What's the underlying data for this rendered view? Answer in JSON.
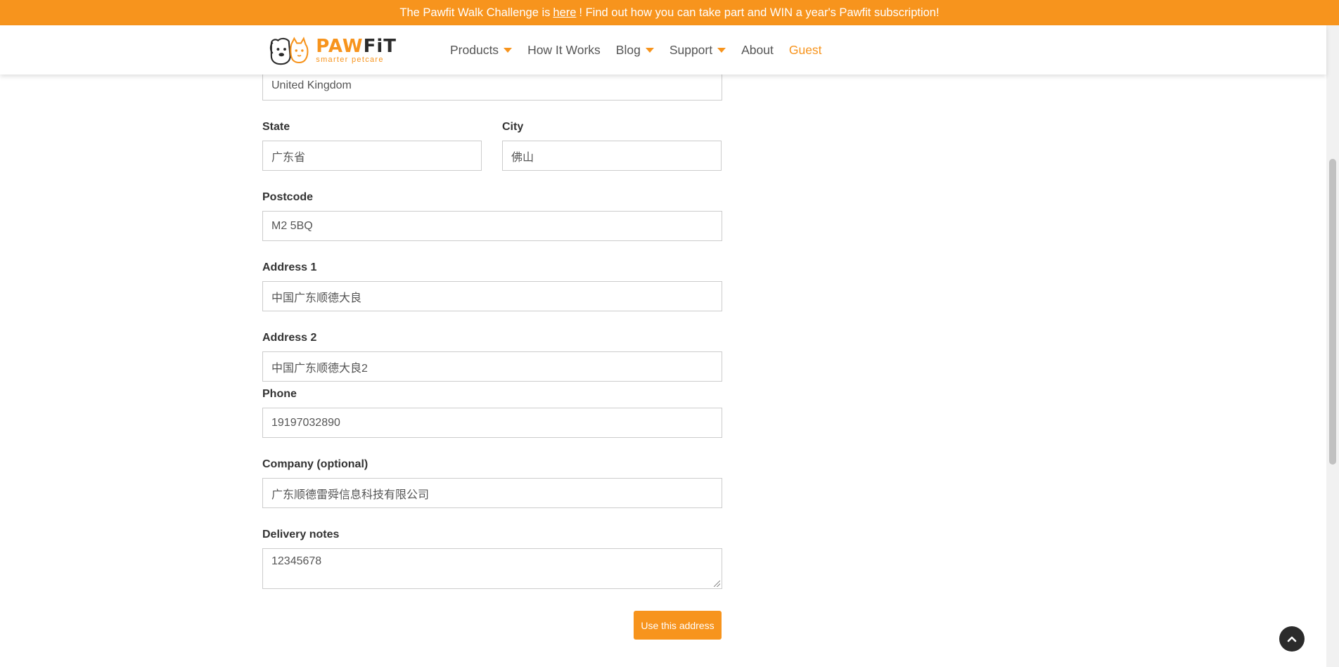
{
  "banner": {
    "text_before": "The Pawfit Walk Challenge is",
    "link": "here",
    "text_after": "! Find out how you can take part and WIN a year's Pawfit subscription!"
  },
  "header": {
    "logo_word_paw": "PAW",
    "logo_word_fit": "FiT",
    "logo_tagline": "smarter petcare",
    "nav": [
      {
        "label": "Products",
        "has_dropdown": true
      },
      {
        "label": "How It Works",
        "has_dropdown": false
      },
      {
        "label": "Blog",
        "has_dropdown": true
      },
      {
        "label": "Support",
        "has_dropdown": true
      },
      {
        "label": "About",
        "has_dropdown": false
      },
      {
        "label": "Guest",
        "has_dropdown": false
      }
    ]
  },
  "form": {
    "country": {
      "value": "United Kingdom"
    },
    "state": {
      "label": "State",
      "value": "广东省"
    },
    "city": {
      "label": "City",
      "value": "佛山"
    },
    "postcode": {
      "label": "Postcode",
      "value": "M2 5BQ"
    },
    "address1": {
      "label": "Address 1",
      "value": "中国广东顺德大良"
    },
    "address2": {
      "label": "Address 2",
      "value": "中国广东顺德大良2"
    },
    "phone": {
      "label": "Phone",
      "value": "19197032890"
    },
    "company": {
      "label": "Company (optional)",
      "value": "广东顺德雷舜信息科技有限公司"
    },
    "delivery_notes": {
      "label": "Delivery notes",
      "value": "12345678"
    },
    "submit_label": "Use this address"
  },
  "colors": {
    "accent": "#f7941d",
    "dark": "#2b2b2b"
  },
  "icons": {
    "back_to_top": "chevron-up-icon",
    "dropdown": "caret-down-icon"
  }
}
